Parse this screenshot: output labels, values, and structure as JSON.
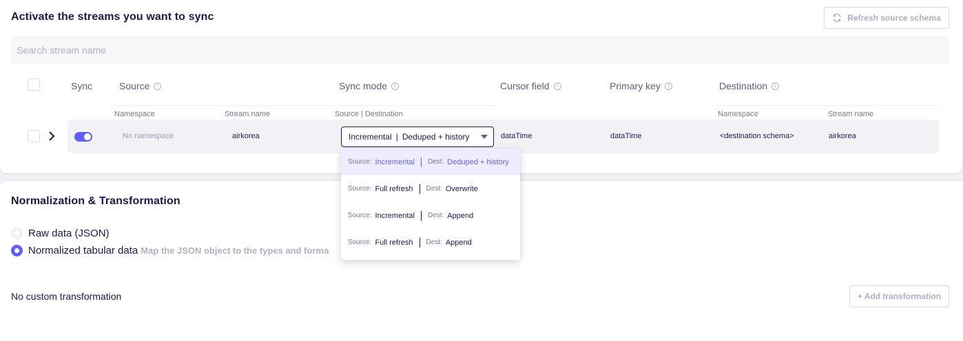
{
  "streams": {
    "title": "Activate the streams you want to sync",
    "refresh_label": "Refresh source schema",
    "search_placeholder": "Search stream name",
    "headers": {
      "sync": "Sync",
      "source": "Source",
      "sync_mode": "Sync mode",
      "cursor_field": "Cursor field",
      "primary_key": "Primary key",
      "destination": "Destination",
      "info_glyph": "i"
    },
    "subheaders": {
      "namespace": "Namespace",
      "stream_name": "Stream name",
      "source_destination": "Source | Destination",
      "dest_namespace": "Namespace",
      "dest_stream_name": "Stream name"
    },
    "row": {
      "namespace": "No namespace",
      "stream_name": "airkorea",
      "sync_mode_source": "Incremental",
      "sync_mode_dest": "Deduped + history",
      "cursor_field": "dataTime",
      "primary_key": "dataTime",
      "dest_namespace": "<destination schema>",
      "dest_stream_name": "airkorea",
      "sync_enabled": true
    },
    "dropdown": {
      "source_label": "Source:",
      "dest_label": "Dest:",
      "options": [
        {
          "source": "Incremental",
          "dest": "Deduped + history",
          "selected": true
        },
        {
          "source": "Full refresh",
          "dest": "Overwrite",
          "selected": false
        },
        {
          "source": "Incremental",
          "dest": "Append",
          "selected": false
        },
        {
          "source": "Full refresh",
          "dest": "Append",
          "selected": false
        }
      ]
    }
  },
  "normalization": {
    "title": "Normalization & Transformation",
    "raw_label": "Raw data (JSON)",
    "normalized_label": "Normalized tabular data",
    "normalized_hint": "Map the JSON object to the types and forma",
    "selected": "normalized",
    "no_transform": "No custom transformation",
    "add_transform_label": "+ Add transformation"
  },
  "colors": {
    "accent": "#615eff",
    "text": "#1a194d",
    "muted": "#afafc1"
  }
}
